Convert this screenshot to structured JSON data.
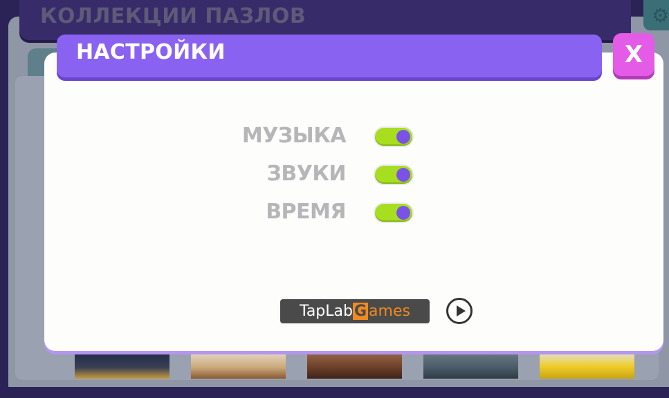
{
  "background": {
    "collections_title": "КОЛЛЕКЦИИ ПАЗЛОВ",
    "settings_icon": "gear-icon"
  },
  "dialog": {
    "title": "НАСТРОЙКИ",
    "close_label": "X",
    "settings": [
      {
        "label": "МУЗЫКА",
        "enabled": true
      },
      {
        "label": "ЗВУКИ",
        "enabled": true
      },
      {
        "label": "ВРЕМЯ",
        "enabled": true
      }
    ],
    "logo_text_prefix": "TapLab",
    "logo_text_g": "G",
    "logo_text_suffix": "ames",
    "play_icon": "play-icon"
  },
  "colors": {
    "accent_purple": "#8a62f2",
    "close_pink": "#e35be6",
    "toggle_on": "#a8de20",
    "label_gray": "#b6b6b9"
  }
}
